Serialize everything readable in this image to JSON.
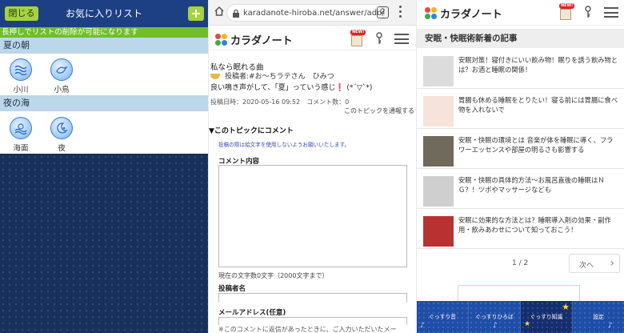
{
  "panel1": {
    "close_label": "閉じる",
    "title": "お気に入りリスト",
    "add_label": "+",
    "notice": "長押しでリストの削除が可能になります",
    "sections": [
      {
        "name": "夏の朝",
        "items": [
          {
            "label": "小川",
            "icon": "stream-icon"
          },
          {
            "label": "小鳥",
            "icon": "bird-icon"
          }
        ]
      },
      {
        "name": "夜の海",
        "items": [
          {
            "label": "海面",
            "icon": "sea-icon"
          },
          {
            "label": "夜",
            "icon": "moon-icon"
          }
        ]
      }
    ]
  },
  "panel2": {
    "url": "karadanote-hiroba.net/answer/add/",
    "tab_count": "2",
    "site_name": "カラダノート",
    "badge": "NEW!",
    "post": {
      "title": "私なら眠れる曲",
      "poster": "投稿者:#お～ちラテさん　ひみつ",
      "body": "良い鳴き声がして、「夏」っていう感じ❗ (*´▽`*)",
      "meta": "投稿日時：2020-05-16 09:52　コメント数：0",
      "report": "このトピックを通報する"
    },
    "comment": {
      "heading": "▼このトピックにコメント",
      "note": "投稿の際は絵文字を使用しないようお願いいたします。",
      "content_label": "コメント内容",
      "char_count": "現在の文字数0文字（2000文字まで）",
      "poster_label": "投稿者名",
      "email_label": "メールアドレス(任意)",
      "email_note": "※このコメントに返信があったときに、ご入力いただいたメー"
    }
  },
  "panel3": {
    "site_name": "カラダノート",
    "badge": "NEW!",
    "section_title": "安眠・快眠術新着の記事",
    "articles": [
      {
        "text": "安眠対策！寝付きにいい飲み物！眠りを誘う飲み物とは？お酒と睡眠の関係！",
        "thumb": "#dcdcdc"
      },
      {
        "text": "胃腸も休める睡眠をとりたい！寝る前には胃腸に食べ物を入れないで",
        "thumb": "#f6e3d9"
      },
      {
        "text": "安眠・快眠の環境とは 音楽が体を睡眠に導く、フラワーエッセンスや部屋の明るさも影響する",
        "thumb": "#6f6a5c"
      },
      {
        "text": "安眠・快眠の具体的方法～お風呂直後の睡眠はＮＧ？！ツボやマッサージなども",
        "thumb": "#cfcfcf"
      },
      {
        "text": "安眠に効果的な方法とは？睡眠導入剤の効果・副作用・飲みあわせについて知っておこう！",
        "thumb": "#b83232"
      }
    ],
    "pager": {
      "page": "1 / 2",
      "next_label": "次へ"
    },
    "nav": [
      {
        "label": "ぐっすり音"
      },
      {
        "label": "ぐっすりひろば"
      },
      {
        "label": "ぐっすり知識"
      },
      {
        "label": "設定"
      }
    ]
  }
}
